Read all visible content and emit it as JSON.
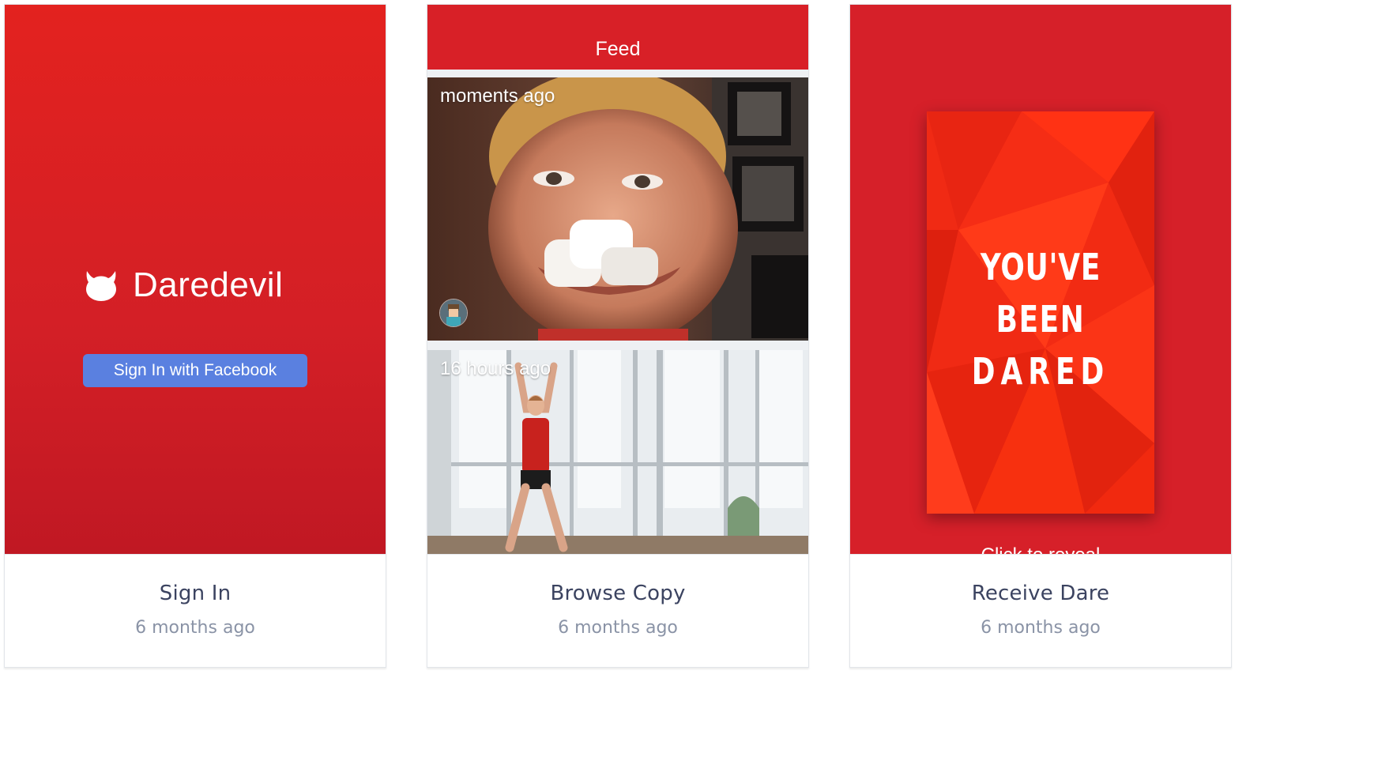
{
  "colors": {
    "brand_red": "#d82027",
    "facebook_blue": "#5a80e0",
    "title_text": "#3b4360",
    "meta_text": "#8a93a6"
  },
  "cards": [
    {
      "title": "Sign In",
      "time": "6 months ago",
      "screen": {
        "brand_icon": "devil-head-icon",
        "brand_name": "Daredevil",
        "button_label": "Sign In with Facebook"
      }
    },
    {
      "title": "Browse Copy",
      "time": "6 months ago",
      "screen": {
        "header_title": "Feed",
        "items": [
          {
            "time": "moments ago",
            "image": "photo-kid-marshmallows",
            "avatar": "user-avatar-icon"
          },
          {
            "time": "16 hours ago",
            "image": "photo-woman-jumping-jacks"
          }
        ]
      }
    },
    {
      "title": "Receive Dare",
      "time": "6 months ago",
      "screen": {
        "poster_lines": [
          "YOU'VE",
          "BEEN",
          "DARED"
        ],
        "reveal_text": "Click to reveal"
      }
    }
  ]
}
